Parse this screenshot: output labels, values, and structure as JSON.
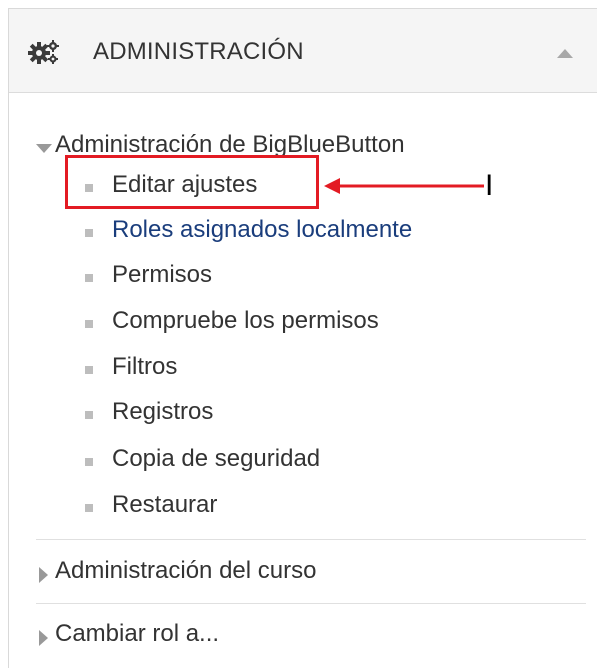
{
  "header": {
    "icon": "gears-icon",
    "title": "ADMINISTRACIÓN",
    "collapse_icon": "chevron-up-icon"
  },
  "tree": {
    "root_label": "Administración de BigBlueButton",
    "items": [
      {
        "label": "Editar ajustes",
        "style": "text"
      },
      {
        "label": "Roles asignados localmente",
        "style": "link"
      },
      {
        "label": "Permisos",
        "style": "text"
      },
      {
        "label": "Compruebe los permisos",
        "style": "text"
      },
      {
        "label": "Filtros",
        "style": "text"
      },
      {
        "label": "Registros",
        "style": "text"
      },
      {
        "label": "Copia de seguridad",
        "style": "text"
      },
      {
        "label": "Restaurar",
        "style": "text"
      }
    ]
  },
  "sections": [
    {
      "label": "Administración del curso"
    },
    {
      "label": "Cambiar rol a..."
    }
  ],
  "annotation": {
    "letter": "I",
    "color": "#e31b23"
  }
}
